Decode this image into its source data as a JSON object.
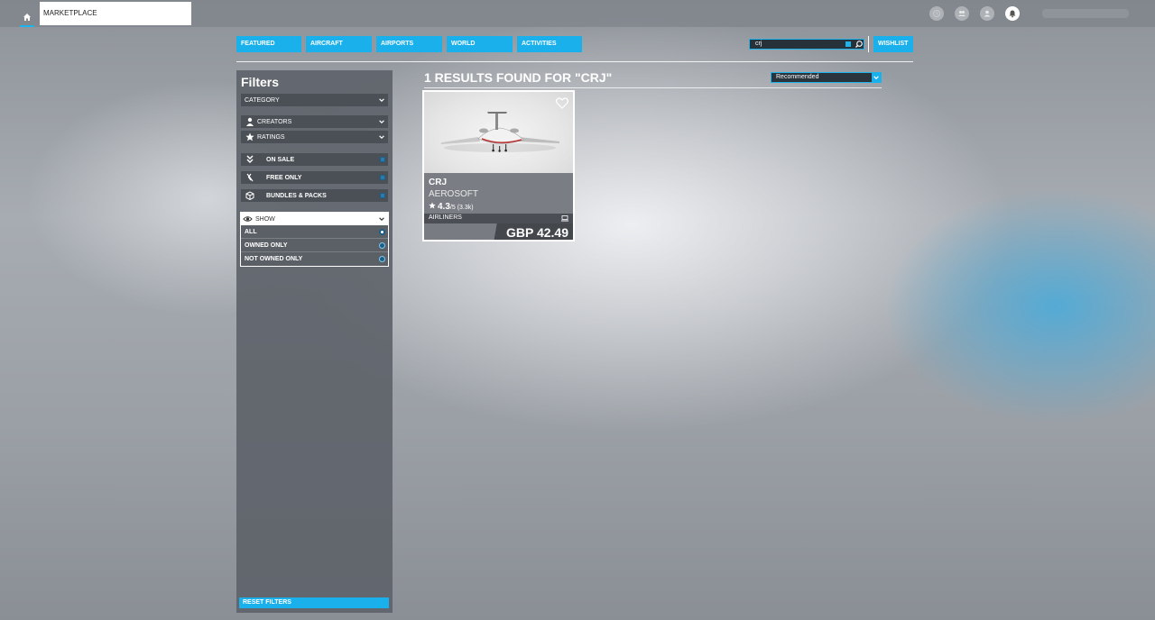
{
  "topbar": {
    "tab_label": "MARKETPLACE",
    "icons": [
      "clock-icon",
      "group-icon",
      "profile-icon",
      "bell-icon"
    ]
  },
  "nav": {
    "items": [
      {
        "label": "FEATURED",
        "width": 72
      },
      {
        "label": "AIRCRAFT",
        "width": 73
      },
      {
        "label": "AIRPORTS",
        "width": 73
      },
      {
        "label": "WORLD",
        "width": 73
      },
      {
        "label": "ACTIVITIES",
        "width": 72
      }
    ],
    "wishlist_label": "WISHLIST"
  },
  "search": {
    "value": "crj"
  },
  "filters": {
    "title": "Filters",
    "category": "CATEGORY",
    "creators": "CREATORS",
    "ratings": "RATINGS",
    "on_sale": "ON SALE",
    "free_only": "FREE ONLY",
    "bundles": "BUNDLES & PACKS",
    "show": "SHOW",
    "show_options": [
      "ALL",
      "OWNED ONLY",
      "NOT OWNED ONLY"
    ],
    "show_selected": "ALL",
    "reset": "RESET FILTERS"
  },
  "results": {
    "title": "1 RESULTS FOUND FOR \"CRJ\"",
    "sort_value": "Recommended"
  },
  "card": {
    "name": "CRJ",
    "developer": "AEROSOFT",
    "rating": "4.3",
    "rating_suffix": "/5 (3.3k)",
    "category": "AIRLINERS",
    "price": "GBP 42.49"
  },
  "colors": {
    "accent": "#19b0ec"
  }
}
